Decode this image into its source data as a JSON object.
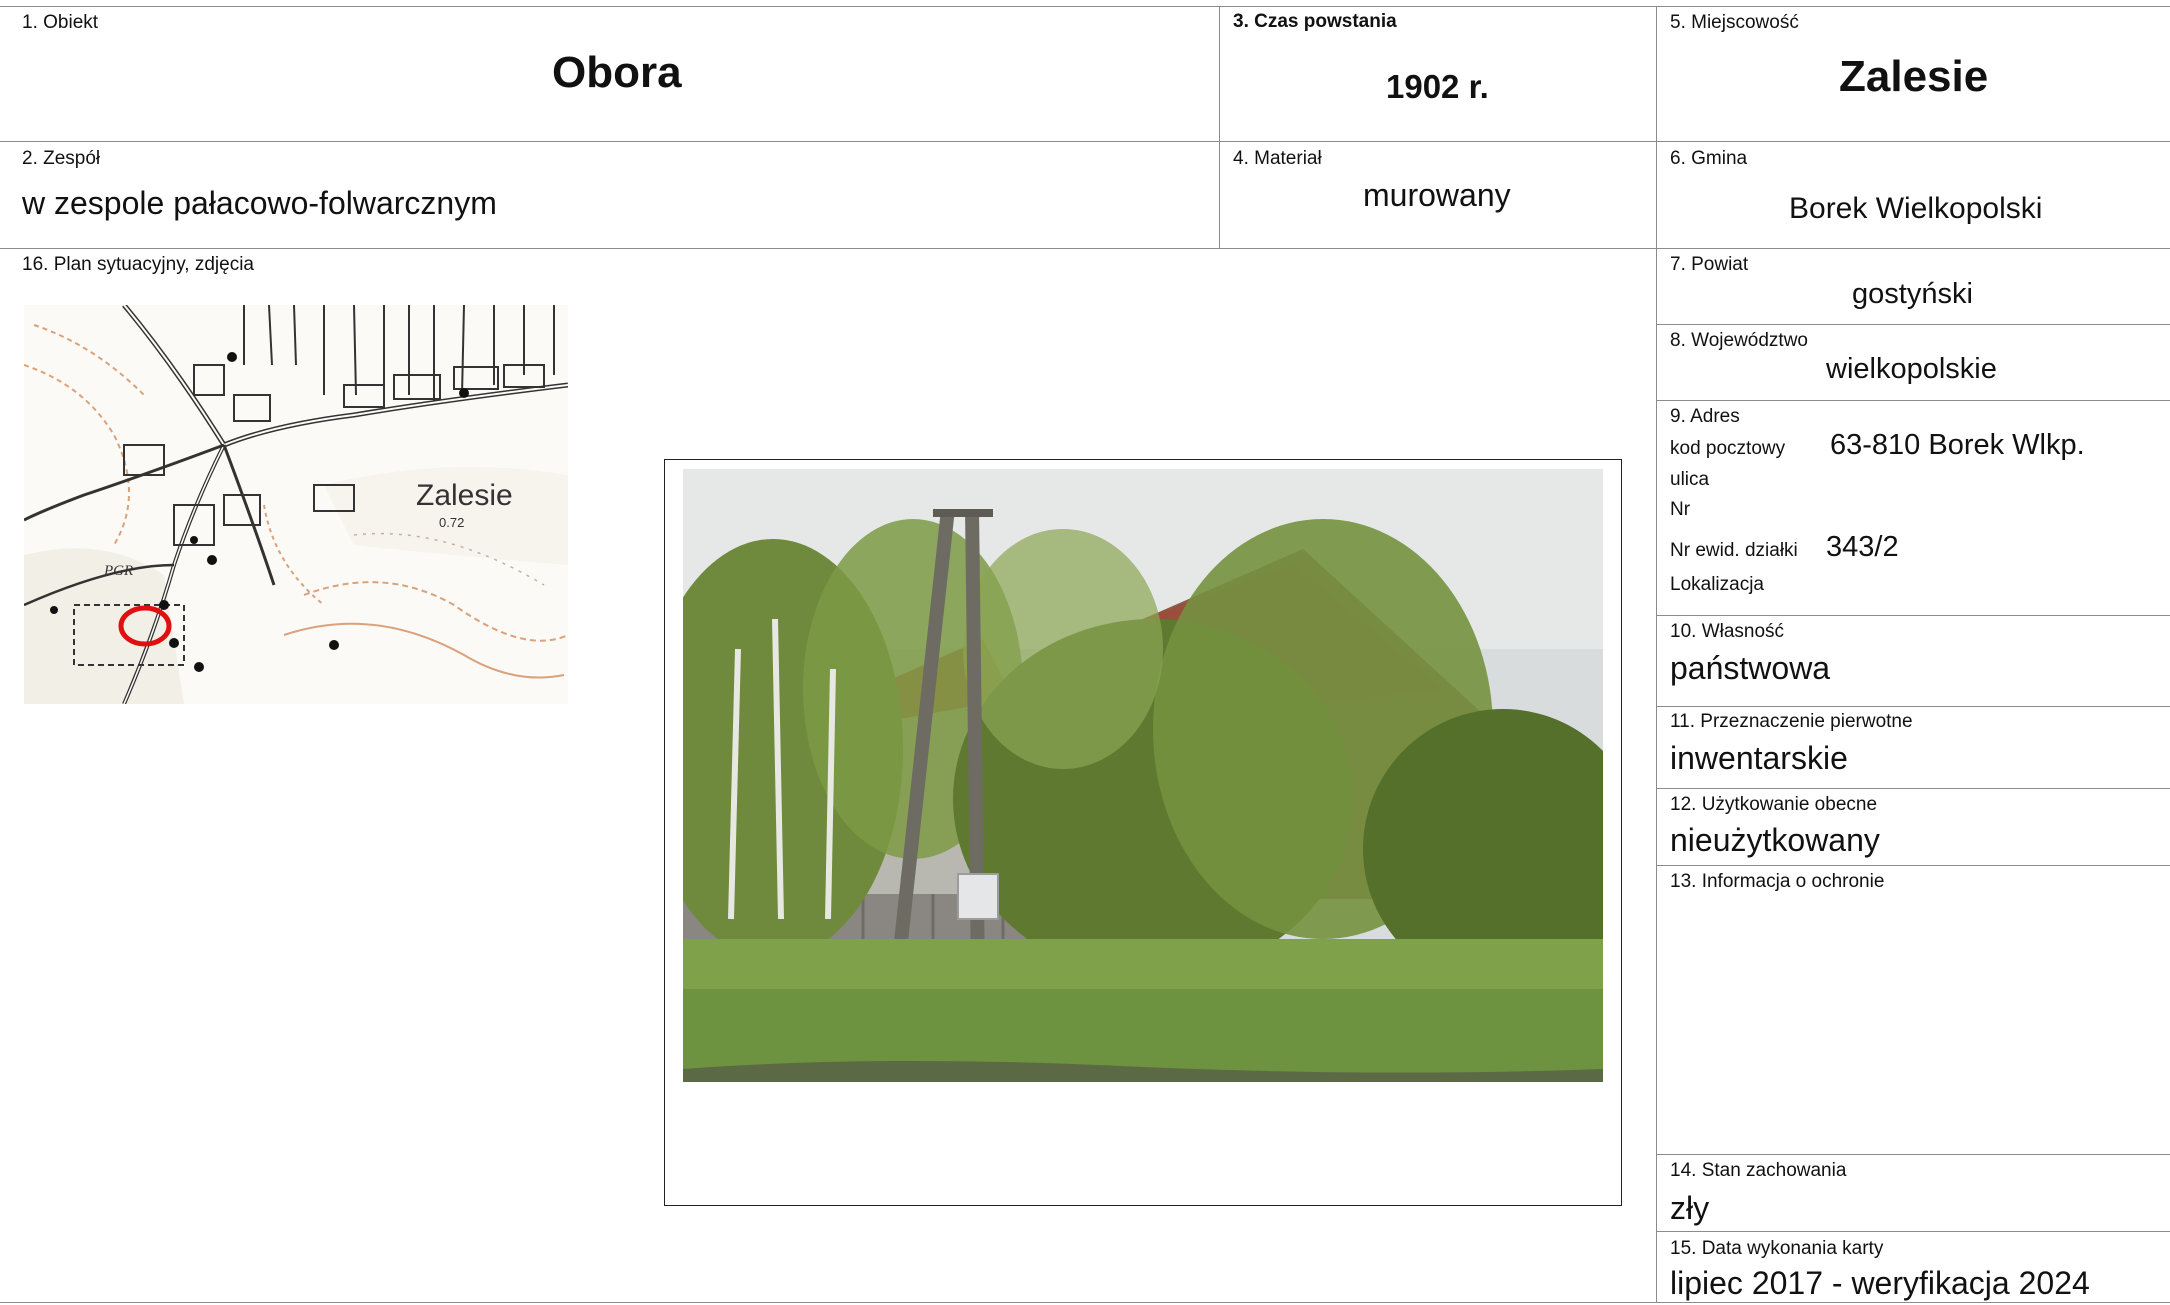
{
  "fields": {
    "obiekt": {
      "label": "1. Obiekt",
      "value": "Obora"
    },
    "zespol": {
      "label": "2. Zespół",
      "value": "w zespole pałacowo-folwarcznym"
    },
    "czas": {
      "label": "3. Czas powstania",
      "value": "1902 r."
    },
    "material": {
      "label": "4. Materiał",
      "value": "murowany"
    },
    "miejscowosc": {
      "label": "5. Miejscowość",
      "value": "Zalesie"
    },
    "gmina": {
      "label": "6. Gmina",
      "value": "Borek Wielkopolski"
    },
    "powiat": {
      "label": "7. Powiat",
      "value": "gostyński"
    },
    "wojewodztwo": {
      "label": "8. Województwo",
      "value": "wielkopolskie"
    },
    "adres": {
      "label": "9. Adres",
      "kod_label": "kod pocztowy",
      "kod_value": "63-810 Borek Wlkp.",
      "ulica_label": "ulica",
      "nr_label": "Nr",
      "dzialka_label": "Nr ewid. działki",
      "dzialka_value": "343/2",
      "lokalizacja_label": "Lokalizacja"
    },
    "wlasnosc": {
      "label": "10. Własność",
      "value": "państwowa"
    },
    "przeznaczenie": {
      "label": "11. Przeznaczenie pierwotne",
      "value": "inwentarskie"
    },
    "uzytkowanie": {
      "label": "12. Użytkowanie obecne",
      "value": "nieużytkowany"
    },
    "ochrona": {
      "label": "13. Informacja o ochronie"
    },
    "stan": {
      "label": "14. Stan zachowania",
      "value": "zły"
    },
    "data": {
      "label": "15. Data wykonania karty",
      "value": "lipiec 2017 - weryfikacja 2024"
    },
    "plan": {
      "label": "16. Plan sytuacyjny, zdjęcia"
    }
  },
  "map": {
    "place_label": "Zalesie",
    "value_label": "0.72",
    "pgr_label": "PGR",
    "marker_color": "#e01010"
  }
}
